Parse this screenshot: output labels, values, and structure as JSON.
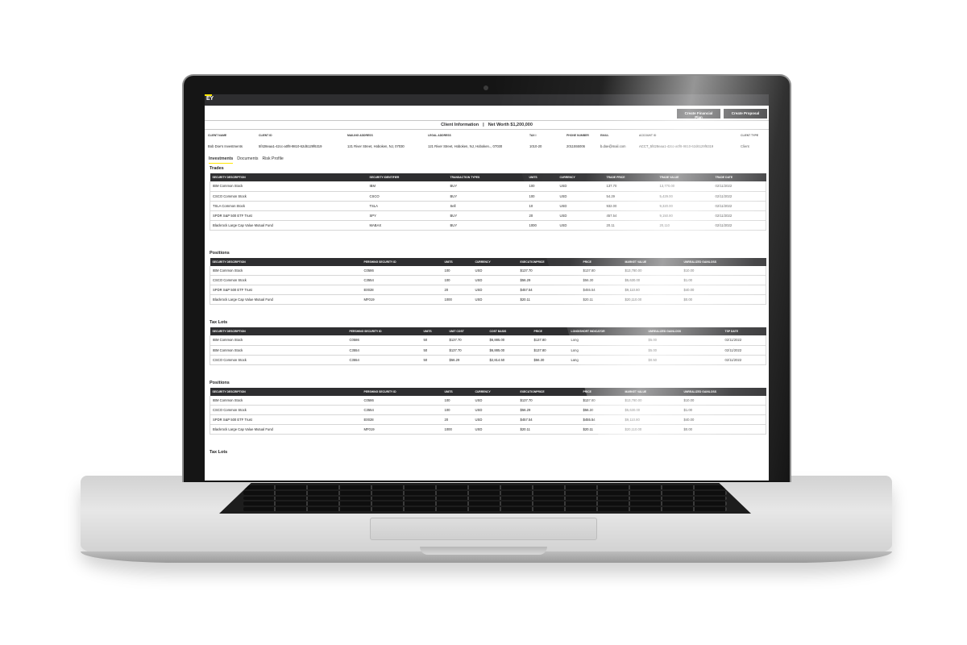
{
  "app": {
    "logo": "EY",
    "buttons": {
      "financial_plan": "Create Financial Plan",
      "proposal": "Create Proposal"
    }
  },
  "net_worth_bar": {
    "title": "Client Information",
    "separator": "|",
    "net_worth": "Net Worth $1,200,000"
  },
  "client": {
    "headers": [
      "CLIENT NAME",
      "CLIENT ID",
      "MAILING ADDRESS",
      "LEGAL ADDRESS",
      "TAX I",
      "PHONE NUMBER",
      "EMAIL",
      "ACCOUNT ID",
      "CLIENT TYPE"
    ],
    "values": [
      "Bob Doe's Investments",
      "5f428eaa1-42cc-a0f8-9810-62d6129f6319",
      "121 River Street, Hoboken, NJ, 07030",
      "121 River Street, Hoboken, NJ, Hoboken.., 07030",
      "1010-20",
      "2011555006",
      "b.doe@mail.com",
      "ACCT_5f428eaa1-42cc-a0f8-9810-62d6129f6319",
      "Client"
    ]
  },
  "tabs": [
    "Investments",
    "Documents",
    "Risk Profile"
  ],
  "sections": {
    "trades": {
      "title": "Trades",
      "headers": [
        "SECURITY DESCRIPTION",
        "SECURITY IDENTIFIER",
        "TRANSACTION TYPES",
        "UNITS",
        "CURRENCY",
        "TRADE PRICE",
        "TRADE VALUE",
        "TRADE DATE"
      ],
      "rows": [
        [
          "IBM Common Stock",
          "IBM",
          "BUY",
          "100",
          "USD",
          "137.70",
          "13,770.00",
          "02/11/2022"
        ],
        [
          "CSCO Common Stock",
          "CSCO",
          "BUY",
          "100",
          "USD",
          "54.29",
          "5,429.00",
          "02/11/2022"
        ],
        [
          "TSLA Common Stock",
          "TSLA",
          "Sell",
          "10",
          "USD",
          "932.00",
          "9,320.00",
          "02/11/2022"
        ],
        [
          "SPDR S&P 500 ETF Trust",
          "SPY",
          "BUY",
          "20",
          "USD",
          "457.54",
          "9,150.80",
          "02/11/2022"
        ],
        [
          "Blackrock Large Cap Value Mutual Fund",
          "MABAX",
          "BUY",
          "1000",
          "USD",
          "20.11",
          "20,110",
          "02/11/2022"
        ]
      ]
    },
    "positions": {
      "title": "Positions",
      "headers": [
        "SECURITY DESCRIPTION",
        "PERSHING SECURITY ID",
        "UNITS",
        "CURRENCY",
        "EXECUTIONPRICE",
        "PRICE",
        "MARKET VALUE",
        "UNREALIZED GAINLOSS"
      ],
      "rows": [
        [
          "IBM Common Stock",
          "C0586",
          "100",
          "USD",
          "$137.70",
          "$137.80",
          "$13,780.00",
          "$10.00"
        ],
        [
          "CSCO Common Stock",
          "C3554",
          "100",
          "USD",
          "$56.29",
          "$56.30",
          "$5,630.00",
          "$1.00"
        ],
        [
          "SPDR S&P 500 ETF Trust",
          "E0028",
          "20",
          "USD",
          "$457.54",
          "$455.54",
          "$9,110.80",
          "$40.00"
        ],
        [
          "Blackrock Large Cap Value Mutual Fund",
          "MF019",
          "1000",
          "USD",
          "$20.11",
          "$20.11",
          "$20,110.00",
          "$0.00"
        ]
      ]
    },
    "tax_lots": {
      "title": "Tax Lots",
      "headers": [
        "SECURITY DESCRIPTION",
        "PERSHING SECURITY ID",
        "UNITS",
        "UNIT COST",
        "COST BASIS",
        "PRICE",
        "LONG/SHORT INDICATOR",
        "UNREALIZED GAINLOSS",
        "TSP DATE"
      ],
      "rows": [
        [
          "IBM Common Stock",
          "C0586",
          "50",
          "$137.70",
          "$6,885.00",
          "$137.80",
          "Long",
          "$5.00",
          "02/11/2022"
        ],
        [
          "IBM Common Stock",
          "C3554",
          "50",
          "$137.70",
          "$6,885.00",
          "$137.80",
          "Long",
          "$5.00",
          "02/11/2022"
        ],
        [
          "CSCO Common Stock",
          "C3554",
          "50",
          "$56.29",
          "$2,814.50",
          "$56.30",
          "Long",
          "$0.50",
          "02/11/2022"
        ]
      ]
    },
    "positions_2": {
      "title": "Positions",
      "headers": [
        "SECURITY DESCRIPTION",
        "PERSHING SECURITY ID",
        "UNITS",
        "CURRENCY",
        "EXECUTIONPRICE",
        "PRICE",
        "MARKET VALUE",
        "UNREALIZED GAINLOSS"
      ],
      "rows": [
        [
          "IBM Common Stock",
          "C0586",
          "100",
          "USD",
          "$137.70",
          "$137.80",
          "$13,780.00",
          "$10.00"
        ],
        [
          "CSCO Common Stock",
          "C3554",
          "100",
          "USD",
          "$56.29",
          "$56.30",
          "$5,630.00",
          "$1.00"
        ],
        [
          "SPDR S&P 500 ETF Trust",
          "E0028",
          "20",
          "USD",
          "$457.54",
          "$455.54",
          "$9,110.80",
          "$40.00"
        ],
        [
          "Blackrock Large Cap Value Mutual Fund",
          "MF019",
          "1000",
          "USD",
          "$20.11",
          "$20.11",
          "$20,110.00",
          "$0.00"
        ]
      ]
    },
    "tax_lots_2": {
      "title": "Tax Lots"
    }
  }
}
